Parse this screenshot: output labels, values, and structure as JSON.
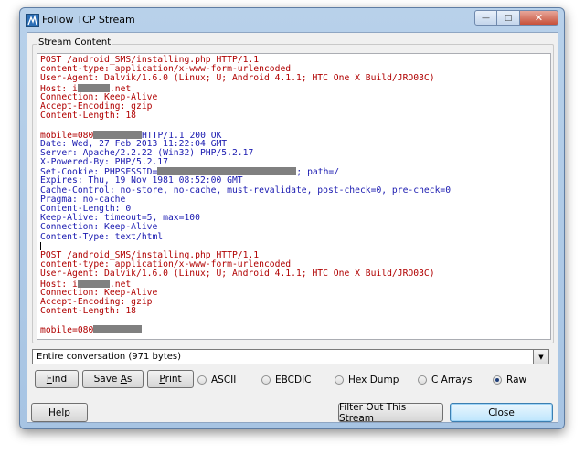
{
  "window": {
    "title": "Follow TCP Stream",
    "minimize_glyph": "—",
    "maximize_glyph": "□",
    "close_glyph": "✕"
  },
  "stream_group_label": "Stream Content",
  "stream_lines": [
    {
      "who": "client",
      "parts": [
        {
          "t": "POST /android_SMS/installing.php HTTP/1.1"
        }
      ]
    },
    {
      "who": "client",
      "parts": [
        {
          "t": "content-type: application/x-www-form-urlencoded"
        }
      ]
    },
    {
      "who": "client",
      "parts": [
        {
          "t": "User-Agent: Dalvik/1.6.0 (Linux; U; Android 4.1.1; HTC One X Build/JRO03C)"
        }
      ]
    },
    {
      "who": "client",
      "parts": [
        {
          "t": "Host: i"
        },
        {
          "redact": 6
        },
        {
          "t": ".net"
        }
      ]
    },
    {
      "who": "client",
      "parts": [
        {
          "t": "Connection: Keep-Alive"
        }
      ]
    },
    {
      "who": "client",
      "parts": [
        {
          "t": "Accept-Encoding: gzip"
        }
      ]
    },
    {
      "who": "client",
      "parts": [
        {
          "t": "Content-Length: 18"
        }
      ]
    },
    {
      "who": "blank",
      "parts": []
    },
    {
      "who": "client",
      "parts": [
        {
          "t": "mobile=080"
        },
        {
          "redact": 9
        },
        {
          "t": "HTTP/1.1 200 OK",
          "who": "server"
        }
      ]
    },
    {
      "who": "server",
      "parts": [
        {
          "t": "Date: Wed, 27 Feb 2013 11:22:04 GMT"
        }
      ]
    },
    {
      "who": "server",
      "parts": [
        {
          "t": "Server: Apache/2.2.22 (Win32) PHP/5.2.17"
        }
      ]
    },
    {
      "who": "server",
      "parts": [
        {
          "t": "X-Powered-By: PHP/5.2.17"
        }
      ]
    },
    {
      "who": "server",
      "parts": [
        {
          "t": "Set-Cookie: PHPSESSID="
        },
        {
          "redact": 26
        },
        {
          "t": "; path=/"
        }
      ]
    },
    {
      "who": "server",
      "parts": [
        {
          "t": "Expires: Thu, 19 Nov 1981 08:52:00 GMT"
        }
      ]
    },
    {
      "who": "server",
      "parts": [
        {
          "t": "Cache-Control: no-store, no-cache, must-revalidate, post-check=0, pre-check=0"
        }
      ]
    },
    {
      "who": "server",
      "parts": [
        {
          "t": "Pragma: no-cache"
        }
      ]
    },
    {
      "who": "server",
      "parts": [
        {
          "t": "Content-Length: 0"
        }
      ]
    },
    {
      "who": "server",
      "parts": [
        {
          "t": "Keep-Alive: timeout=5, max=100"
        }
      ]
    },
    {
      "who": "server",
      "parts": [
        {
          "t": "Connection: Keep-Alive"
        }
      ]
    },
    {
      "who": "server",
      "parts": [
        {
          "t": "Content-Type: text/html"
        }
      ]
    },
    {
      "who": "caret",
      "parts": []
    },
    {
      "who": "client",
      "parts": [
        {
          "t": "POST /android_SMS/installing.php HTTP/1.1"
        }
      ]
    },
    {
      "who": "client",
      "parts": [
        {
          "t": "content-type: application/x-www-form-urlencoded"
        }
      ]
    },
    {
      "who": "client",
      "parts": [
        {
          "t": "User-Agent: Dalvik/1.6.0 (Linux; U; Android 4.1.1; HTC One X Build/JRO03C)"
        }
      ]
    },
    {
      "who": "client",
      "parts": [
        {
          "t": "Host: i"
        },
        {
          "redact": 6
        },
        {
          "t": ".net"
        }
      ]
    },
    {
      "who": "client",
      "parts": [
        {
          "t": "Connection: Keep-Alive"
        }
      ]
    },
    {
      "who": "client",
      "parts": [
        {
          "t": "Accept-Encoding: gzip"
        }
      ]
    },
    {
      "who": "client",
      "parts": [
        {
          "t": "Content-Length: 18"
        }
      ]
    },
    {
      "who": "blank",
      "parts": []
    },
    {
      "who": "client",
      "parts": [
        {
          "t": "mobile=080"
        },
        {
          "redact": 9
        }
      ]
    }
  ],
  "colors": {
    "client_text": "#b00000",
    "server_text": "#1a1ab0",
    "redaction": "#808080"
  },
  "conversation_select": {
    "selected": "Entire conversation (971 bytes)",
    "arrow": "▼"
  },
  "buttons": {
    "find": {
      "pre": "",
      "ul": "F",
      "post": "ind"
    },
    "save_as": {
      "pre": "Save ",
      "ul": "A",
      "post": "s"
    },
    "print": {
      "pre": "",
      "ul": "P",
      "post": "rint"
    },
    "help": {
      "pre": "",
      "ul": "H",
      "post": "elp"
    },
    "filter_out": "Filter Out This Stream",
    "close": {
      "pre": "",
      "ul": "C",
      "post": "lose"
    }
  },
  "formats": [
    {
      "label": "ASCII",
      "selected": false
    },
    {
      "label": "EBCDIC",
      "selected": false
    },
    {
      "label": "Hex Dump",
      "selected": false
    },
    {
      "label": "C Arrays",
      "selected": false
    },
    {
      "label": "Raw",
      "selected": true
    }
  ]
}
